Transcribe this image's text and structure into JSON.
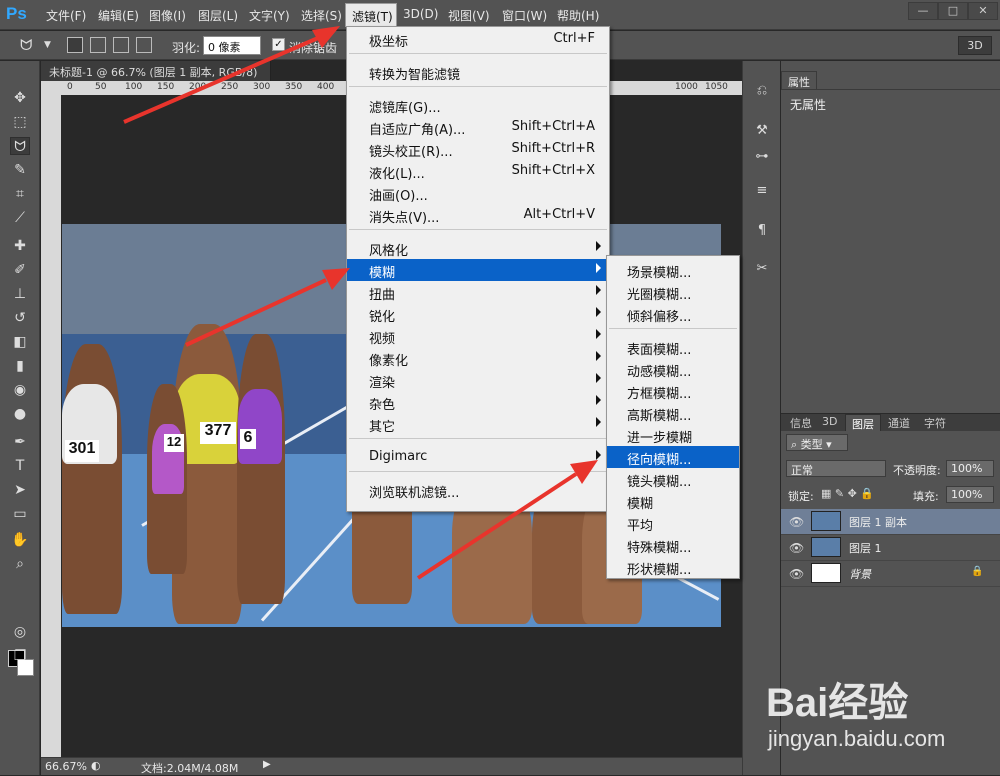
{
  "app": {
    "logo": "Ps"
  },
  "menubar": {
    "items": [
      "文件(F)",
      "编辑(E)",
      "图像(I)",
      "图层(L)",
      "文字(Y)",
      "选择(S)",
      "滤镜(T)",
      "3D(D)",
      "视图(V)",
      "窗口(W)",
      "帮助(H)"
    ],
    "active": "滤镜(T)",
    "window_controls": [
      "—",
      "□",
      "✕"
    ]
  },
  "options": {
    "feather_label": "羽化:",
    "feather_value": "0 像素",
    "antialias_label": "消除锯齿",
    "workspace_label": "3D"
  },
  "document": {
    "tab_title": "未标题-1 @ 66.7% (图层 1 副本, RGB/8) *",
    "ruler_h": [
      "0",
      "50",
      "100",
      "150",
      "200",
      "250",
      "300",
      "350",
      "400",
      "1000",
      "1050"
    ],
    "zoom": "66.67%",
    "doc_size": "文档:2.04M/4.08M",
    "bibs": [
      "301",
      "377",
      "6",
      "12"
    ]
  },
  "filter_menu": {
    "items": [
      {
        "label": "极坐标",
        "shortcut": "Ctrl+F"
      },
      {
        "label": "转换为智能滤镜",
        "shortcut": ""
      },
      {
        "label": "滤镜库(G)...",
        "shortcut": ""
      },
      {
        "label": "自适应广角(A)...",
        "shortcut": "Shift+Ctrl+A"
      },
      {
        "label": "镜头校正(R)...",
        "shortcut": "Shift+Ctrl+R"
      },
      {
        "label": "液化(L)...",
        "shortcut": "Shift+Ctrl+X"
      },
      {
        "label": "油画(O)...",
        "shortcut": ""
      },
      {
        "label": "消失点(V)...",
        "shortcut": "Alt+Ctrl+V"
      },
      {
        "label": "风格化",
        "submenu": true
      },
      {
        "label": "模糊",
        "submenu": true,
        "highlighted": true
      },
      {
        "label": "扭曲",
        "submenu": true
      },
      {
        "label": "锐化",
        "submenu": true
      },
      {
        "label": "视频",
        "submenu": true
      },
      {
        "label": "像素化",
        "submenu": true
      },
      {
        "label": "渲染",
        "submenu": true
      },
      {
        "label": "杂色",
        "submenu": true
      },
      {
        "label": "其它",
        "submenu": true
      },
      {
        "label": "Digimarc",
        "submenu": true
      },
      {
        "label": "浏览联机滤镜...",
        "shortcut": ""
      }
    ]
  },
  "blur_menu": {
    "items": [
      "场景模糊...",
      "光圈模糊...",
      "倾斜偏移...",
      "表面模糊...",
      "动感模糊...",
      "方框模糊...",
      "高斯模糊...",
      "进一步模糊",
      "径向模糊...",
      "镜头模糊...",
      "模糊",
      "平均",
      "特殊模糊...",
      "形状模糊..."
    ],
    "highlighted": "径向模糊..."
  },
  "properties": {
    "tab": "属性",
    "body": "无属性"
  },
  "layers": {
    "tabs": [
      "信息",
      "3D",
      "图层",
      "通道",
      "字符"
    ],
    "active_tab": "图层",
    "kind_filter": "类型",
    "blend_mode": "正常",
    "opacity_label": "不透明度:",
    "opacity_value": "100%",
    "lock_label": "锁定:",
    "fill_label": "填充:",
    "fill_value": "100%",
    "rows": [
      {
        "name": "图层 1 副本",
        "selected": true
      },
      {
        "name": "图层 1",
        "selected": false
      },
      {
        "name": "背景",
        "selected": false
      }
    ]
  },
  "watermark": {
    "logo": "Bai经验",
    "url": "jingyan.baidu.com"
  },
  "colors": {
    "highlight": "#0a62c8",
    "arrow": "#e8342c"
  }
}
